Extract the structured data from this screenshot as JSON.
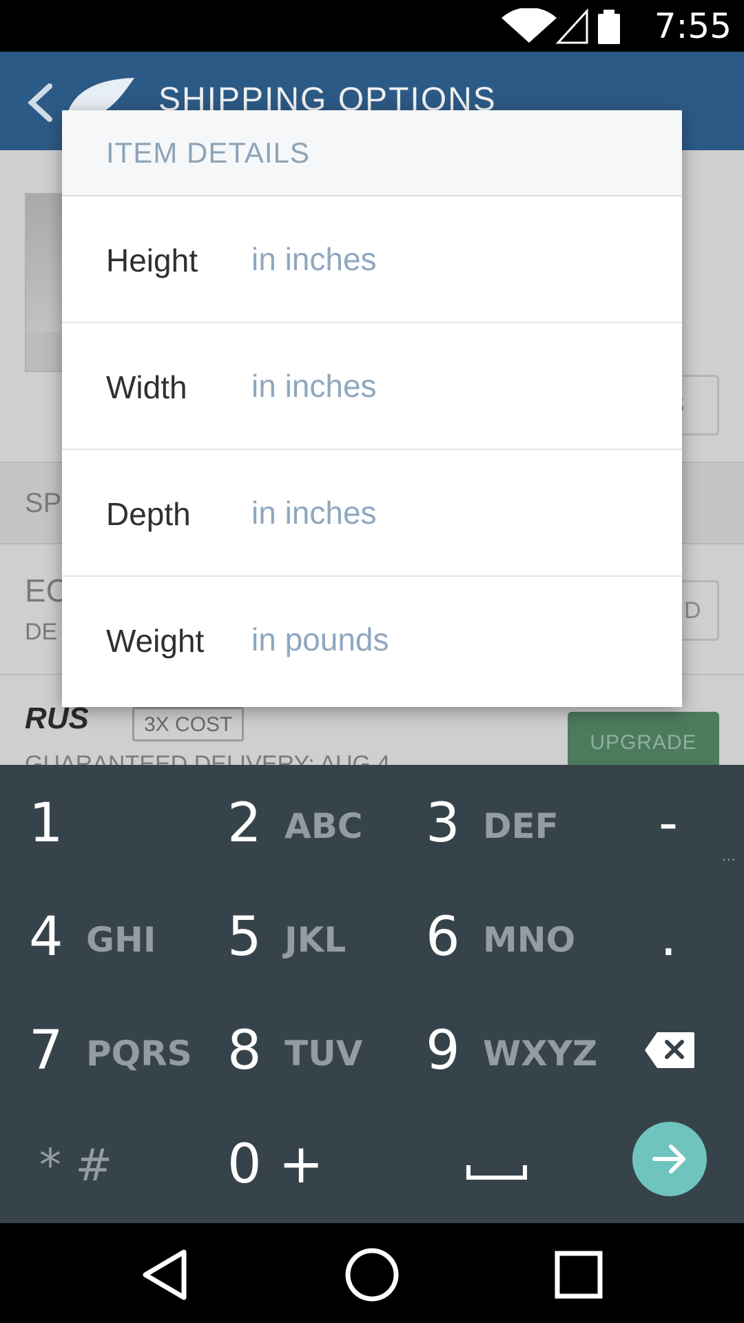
{
  "status_bar": {
    "time": "7:55",
    "icons": [
      "wifi-icon",
      "cell-signal-icon",
      "battery-icon"
    ]
  },
  "app_bar": {
    "title": "SHIPPING OPTIONS",
    "icons": [
      "back-arrow-icon",
      "wing-logo-icon"
    ]
  },
  "background": {
    "side_button_fragment": "S",
    "section_header_fragment": "SP",
    "option_title_fragment": "EC",
    "option_subtitle_fragment": "DE",
    "option_button_fragment": "D",
    "rus_option": {
      "label": "RUS",
      "badge": "3X COST",
      "button": "UPGRADE",
      "subtitle": "GUARANTEED DELIVERY: AUG 4"
    }
  },
  "dialog": {
    "title": "ITEM DETAILS",
    "fields": [
      {
        "label": "Height",
        "placeholder": "in inches",
        "value": ""
      },
      {
        "label": "Width",
        "placeholder": "in inches",
        "value": ""
      },
      {
        "label": "Depth",
        "placeholder": "in inches",
        "value": ""
      },
      {
        "label": "Weight",
        "placeholder": "in pounds",
        "value": ""
      }
    ]
  },
  "keyboard": {
    "keys": [
      {
        "num": "1",
        "letters": ""
      },
      {
        "num": "2",
        "letters": "ABC"
      },
      {
        "num": "3",
        "letters": "DEF"
      },
      {
        "sym": "-"
      },
      {
        "num": "4",
        "letters": "GHI"
      },
      {
        "num": "5",
        "letters": "JKL"
      },
      {
        "num": "6",
        "letters": "MNO"
      },
      {
        "sym": "."
      },
      {
        "num": "7",
        "letters": "PQRS"
      },
      {
        "num": "8",
        "letters": "TUV"
      },
      {
        "num": "9",
        "letters": "WXYZ"
      },
      {
        "icon": "backspace-icon"
      },
      {
        "sym": "* #"
      },
      {
        "sym": "0 +"
      },
      {
        "icon": "space-bar-icon"
      },
      {
        "icon": "enter-arrow-icon"
      }
    ],
    "more_indicator": "...",
    "colors": {
      "background": "#37434a",
      "enter": "#6fc5bd"
    }
  },
  "nav_bar": {
    "icons": [
      "nav-back-icon",
      "nav-home-icon",
      "nav-recents-icon"
    ]
  }
}
